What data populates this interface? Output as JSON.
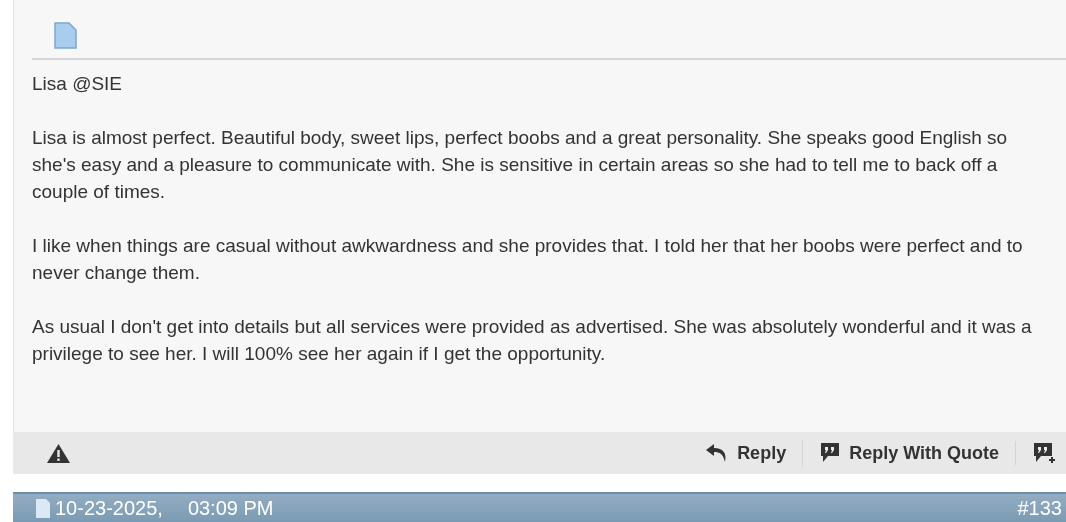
{
  "post": {
    "title": "Lisa @SIE",
    "paragraphs": [
      "Lisa is almost perfect. Beautiful body, sweet lips, perfect boobs and a great personality. She speaks good English so she's easy and a pleasure to communicate with. She is sensitive in certain areas so she had to tell me to back off a couple of times.",
      "I like when things are casual without awkwardness and she provides that. I told her that her boobs were perfect and to never change them.",
      "As usual I don't get into details but all services were provided as advertised. She was absolutely wonderful and it was a privilege to see her. I will 100% see her again if I get the opportunity."
    ],
    "actions": [
      {
        "kind": "reply",
        "label": "Reply"
      },
      {
        "kind": "quote",
        "label": "Reply With Quote"
      },
      {
        "kind": "multiquote"
      }
    ]
  },
  "next_post": {
    "date": "10-23-2025,",
    "time": "03:09 PM",
    "number": "#133"
  }
}
